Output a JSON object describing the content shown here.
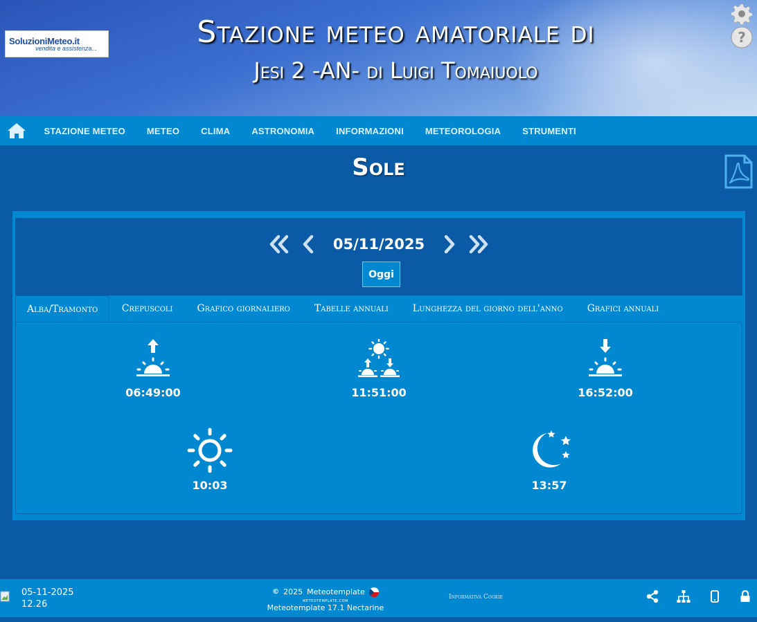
{
  "header": {
    "logo_main": "SoluzioniMeteo.it",
    "logo_sub": "vendita e assistenza...",
    "title_line1": "Stazione meteo amatoriale di",
    "title_line2": "Jesi 2 -AN- di Luigi Tomaiuolo",
    "icons": [
      "gear-icon",
      "help-icon"
    ]
  },
  "nav": {
    "home_icon": "home-icon",
    "items": [
      "STAZIONE METEO",
      "METEO",
      "CLIMA",
      "ASTRONOMIA",
      "INFORMAZIONI",
      "METEOROLOGIA",
      "STRUMENTI"
    ]
  },
  "page": {
    "title": "Sole",
    "pdf_icon": "pdf-icon"
  },
  "date_selector": {
    "date": "05/11/2025",
    "today_label": "Oggi"
  },
  "tabs": [
    "Alba/Tramonto",
    "Crepuscoli",
    "Grafico giornaliero",
    "Tabelle annuali",
    "Lunghezza del giorno dell'anno",
    "Grafici annuali"
  ],
  "active_tab": "Alba/Tramonto",
  "sun": {
    "sunrise": {
      "icon": "sunrise-icon",
      "value": "06:49:00"
    },
    "transit": {
      "icon": "solar-noon-icon",
      "value": "11:51:00"
    },
    "sunset": {
      "icon": "sunset-icon",
      "value": "16:52:00"
    },
    "daylight": {
      "icon": "sun-icon",
      "value": "10:03"
    },
    "night": {
      "icon": "moon-stars-icon",
      "value": "13:57"
    }
  },
  "footer": {
    "date": "05-11-2025",
    "time": "12.26",
    "copyright_year": "2025",
    "copyright_name": "Meteotemplate",
    "site": "meteotemplate.com",
    "version": "Meteotemplate 17.1 Nectarine",
    "cookie": "Informativa Cookie",
    "icons": [
      "share-icon",
      "sitemap-icon",
      "mobile-icon",
      "lock-icon"
    ]
  },
  "colors": {
    "background": "#0a5aa5",
    "nav": "#0288d1",
    "panel": "#0288d1"
  }
}
